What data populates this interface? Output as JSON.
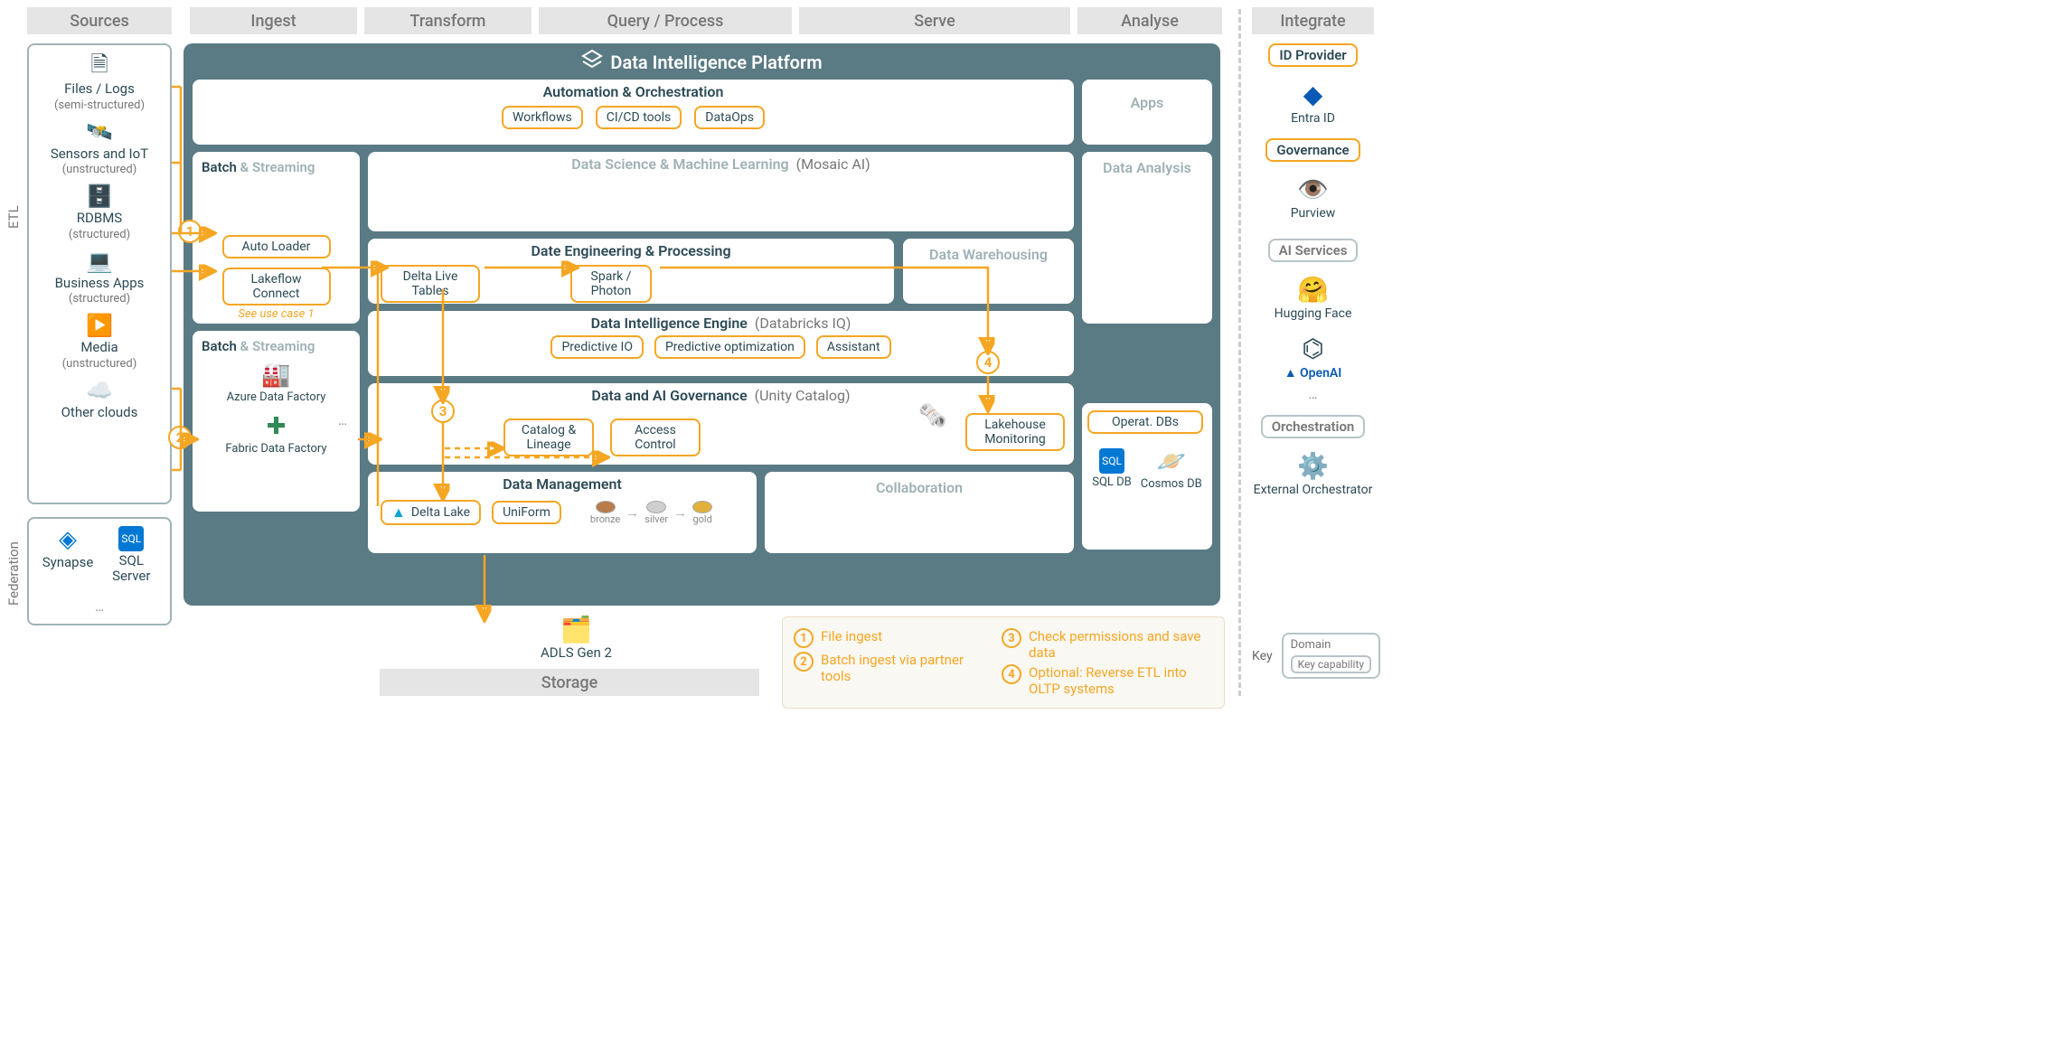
{
  "columns": [
    "Sources",
    "Ingest",
    "Transform",
    "Query / Process",
    "Serve",
    "Analyse",
    "Integrate"
  ],
  "side_labels": {
    "etl": "ETL",
    "federation": "Federation"
  },
  "platform_title": "Data Intelligence Platform",
  "sources": [
    {
      "name": "Files / Logs",
      "sub": "(semi-structured)",
      "icon": "file"
    },
    {
      "name": "Sensors and IoT",
      "sub": "(unstructured)",
      "icon": "iot"
    },
    {
      "name": "RDBMS",
      "sub": "(structured)",
      "icon": "db"
    },
    {
      "name": "Business Apps",
      "sub": "(structured)",
      "icon": "app"
    },
    {
      "name": "Media",
      "sub": "(unstructured)",
      "icon": "media"
    },
    {
      "name": "Other clouds",
      "sub": "",
      "icon": "cloud"
    }
  ],
  "federation": [
    {
      "name": "Synapse",
      "icon": "synapse"
    },
    {
      "name": "SQL Server",
      "icon": "sql"
    }
  ],
  "federation_more": "…",
  "ingest": {
    "group1_label": {
      "main": "Batch",
      "muted": " & Streaming"
    },
    "auto_loader": "Auto Loader",
    "lakeflow": "Lakeflow Connect",
    "seecase": "See use case 1",
    "group2_label": {
      "main": "Batch",
      "muted": " & Streaming"
    },
    "adf": "Azure Data Factory",
    "fdf": "Fabric Data Factory",
    "more": "…"
  },
  "automation": {
    "title": "Automation & Orchestration",
    "caps": [
      "Workflows",
      "CI/CD tools",
      "DataOps"
    ]
  },
  "apps_title": "Apps",
  "dsml": {
    "title": "Data Science & Machine Learning",
    "paren": "(Mosaic AI)"
  },
  "data_analysis_title": "Data Analysis",
  "de": {
    "title": "Date Engineering & Processing",
    "caps": [
      "Delta Live Tables",
      "Spark / Photon"
    ]
  },
  "dw_title": "Data Warehousing",
  "die": {
    "title": "Data Intelligence Engine",
    "paren": "(Databricks IQ)",
    "caps": [
      "Predictive IO",
      "Predictive optimization",
      "Assistant"
    ]
  },
  "gov": {
    "title": "Data and AI Governance",
    "paren": "(Unity Catalog)",
    "caps": [
      "Catalog & Lineage",
      "Access Control",
      "Lakehouse Monitoring"
    ]
  },
  "dm": {
    "title": "Data Management",
    "caps": [
      "Delta Lake",
      "UniForm"
    ],
    "medallion": [
      "bronze",
      "silver",
      "gold"
    ]
  },
  "collab_title": "Collaboration",
  "serve_dbs": {
    "title": "Operat. DBs",
    "items": [
      "SQL DB",
      "Cosmos DB"
    ]
  },
  "storage": {
    "adls": "ADLS Gen 2",
    "footer": "Storage"
  },
  "legend": [
    {
      "n": "1",
      "t": "File ingest"
    },
    {
      "n": "2",
      "t": "Batch ingest via partner tools"
    },
    {
      "n": "3",
      "t": "Check permissions and save data"
    },
    {
      "n": "4",
      "t": "Optional: Reverse ETL into OLTP systems"
    }
  ],
  "integrate": {
    "idp": {
      "label": "ID Provider",
      "items": [
        {
          "name": "Entra ID",
          "icon": "entra"
        }
      ]
    },
    "gov": {
      "label": "Governance",
      "items": [
        {
          "name": "Purview",
          "icon": "purview"
        }
      ]
    },
    "ai": {
      "label": "AI Services",
      "items": [
        {
          "name": "Hugging Face",
          "icon": "hf"
        },
        {
          "name": "OpenAI",
          "icon": "openai"
        }
      ],
      "more": "…"
    },
    "orc": {
      "label": "Orchestration",
      "items": [
        {
          "name": "External Orchestrator",
          "icon": "orch"
        }
      ]
    }
  },
  "key": {
    "label": "Key",
    "domain": "Domain",
    "capability": "Key capability"
  }
}
